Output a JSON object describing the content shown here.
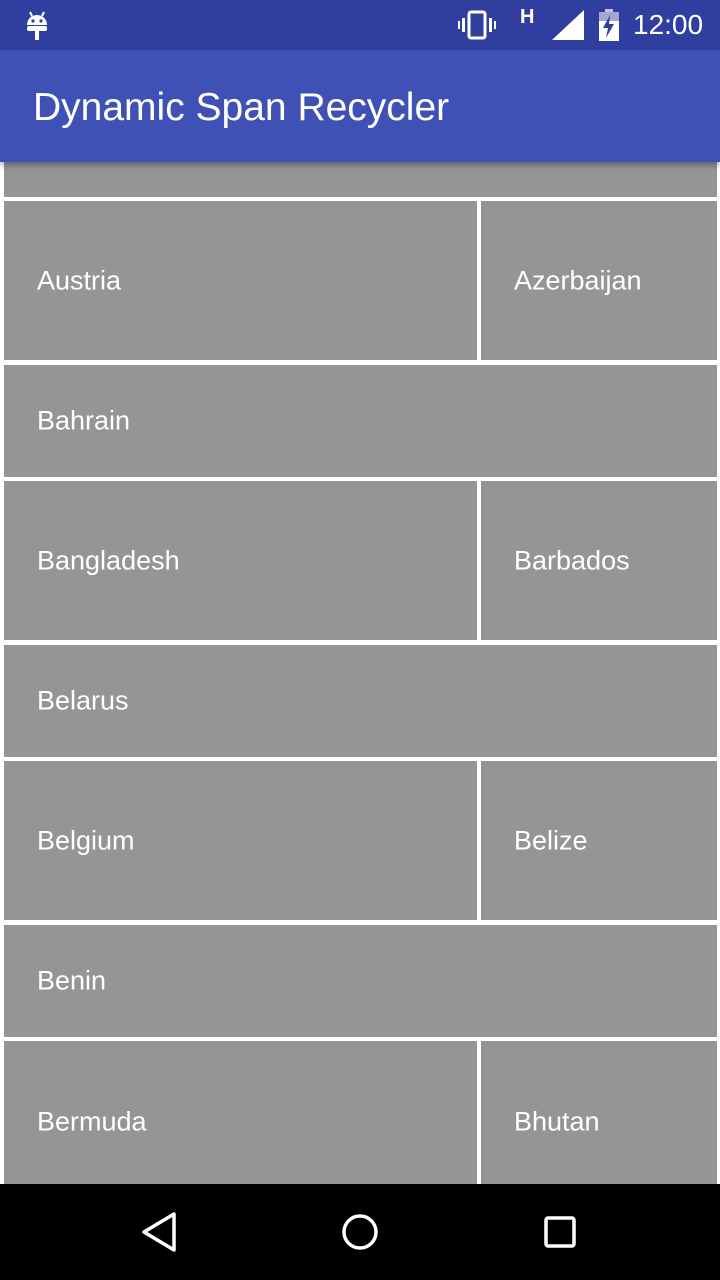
{
  "status_bar": {
    "network_type": "H",
    "time": "12:00",
    "icons": [
      "android-icon",
      "vibrate-icon",
      "signal-icon",
      "battery-charging-icon"
    ]
  },
  "app_bar": {
    "title": "Dynamic Span Recycler",
    "color": "#3f51b5",
    "status_color": "#303f9f"
  },
  "list": {
    "item_color": "#959595",
    "items": [
      {
        "label": ""
      },
      {
        "label": "Austria"
      },
      {
        "label": "Azerbaijan"
      },
      {
        "label": "Bahrain"
      },
      {
        "label": "Bangladesh"
      },
      {
        "label": "Barbados"
      },
      {
        "label": "Belarus"
      },
      {
        "label": "Belgium"
      },
      {
        "label": "Belize"
      },
      {
        "label": "Benin"
      },
      {
        "label": "Bermuda"
      },
      {
        "label": "Bhutan"
      }
    ]
  },
  "nav_bar": {
    "icons": [
      "back-icon",
      "home-icon",
      "recents-icon"
    ]
  }
}
